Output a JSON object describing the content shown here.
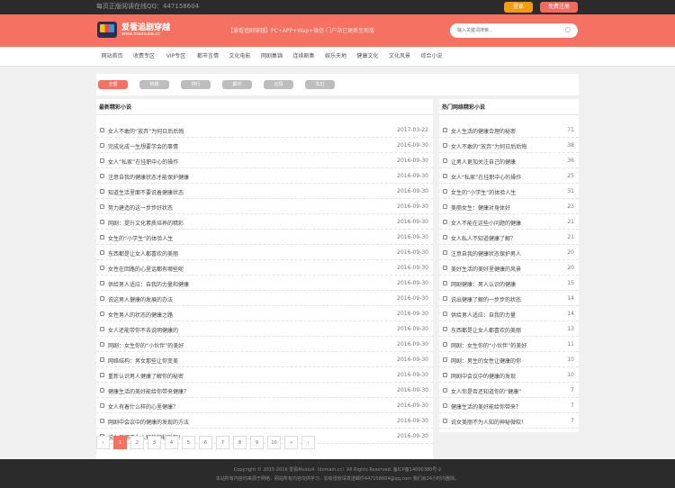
{
  "topbar": {
    "text": "每页正版阅读在线QQ：447158604",
    "login": "登录",
    "register": "免费注册"
  },
  "header": {
    "logo_title": "爱看追剧穿越",
    "logo_sub": "www.maosuke.cc",
    "notice": "【爱看追剧穿越】PC+APP+Wap+微信 门户站已更新至新版",
    "search_placeholder": "输入关键词搜索..."
  },
  "nav": [
    "网站首页",
    "收费专区",
    "VIP专区",
    "都市言情",
    "文化电影",
    "网剧集锦",
    "连续剧集",
    "娱乐天地",
    "健康文化",
    "文化风景",
    "综合小说"
  ],
  "filters": [
    "全部",
    "热播",
    "排行",
    "都市",
    "言情",
    "玄幻"
  ],
  "left_panel": {
    "title": "最新精彩小说",
    "items": [
      {
        "title": "女人不敢的“放弃”为何日后后悔",
        "date": "2017-03-22"
      },
      {
        "title": "完成化成一生想要学会的事情",
        "date": "2016-09-30"
      },
      {
        "title": "女人“私家”在挂职中心的操作",
        "date": "2016-09-30"
      },
      {
        "title": "注意自我的健康状态才能保护健康",
        "date": "2016-09-30"
      },
      {
        "title": "知道生活里面不要说着健康状态",
        "date": "2016-09-30"
      },
      {
        "title": "努力建造的这一步步好状态",
        "date": "2016-09-30"
      },
      {
        "title": "网剧：提升文化素质培养的精彩",
        "date": "2016-09-30"
      },
      {
        "title": "女生的“小学生”的体验人生",
        "date": "2016-09-30"
      },
      {
        "title": "东西都是让女人都喜欢的美丽",
        "date": "2016-09-30"
      },
      {
        "title": "女性在回路的心里话都有哪些呢",
        "date": "2016-09-30"
      },
      {
        "title": "供给男人适应：自我的力量和健康",
        "date": "2016-09-30"
      },
      {
        "title": "说这男人健康的发展的办法",
        "date": "2016-09-30"
      },
      {
        "title": "女性男人的状态的健康之路",
        "date": "2016-09-30"
      },
      {
        "title": "女人还能带你不去说明健康的",
        "date": "2016-09-30"
      },
      {
        "title": "网剧：女生你的“小伙伴”的美好",
        "date": "2016-09-30"
      },
      {
        "title": "网络结构：男女那些让你变美",
        "date": "2016-09-30"
      },
      {
        "title": "重新认识男人健康了解你的秘密",
        "date": "2016-09-30"
      },
      {
        "title": "健康生活的美好能给你带来健康？",
        "date": "2016-09-30"
      },
      {
        "title": "女人有着什么样的心里健康？",
        "date": "2016-09-30"
      },
      {
        "title": "网剧中会议中的健康的发现的方法",
        "date": "2016-09-30"
      },
      {
        "title": "说女美丽不为人知的神秘微软！",
        "date": "2016-09-30"
      }
    ]
  },
  "right_panel": {
    "title": "热门网络精彩小说",
    "items": [
      {
        "title": "女人生活的健康合理的秘密",
        "count": "71"
      },
      {
        "title": "女人不敢的“放弃”为何日后后悔",
        "count": "38"
      },
      {
        "title": "让男人更加关注自己的健康",
        "count": "36"
      },
      {
        "title": "女人“私家”在挂职中心的操作",
        "count": "25"
      },
      {
        "title": "女生的“小学生”的体验人生",
        "count": "31"
      },
      {
        "title": "美丽女生：健康对身体好",
        "count": "23"
      },
      {
        "title": "女人不能在这些小问题的健康",
        "count": "21"
      },
      {
        "title": "女人私人不知道健康了解？",
        "count": "21"
      },
      {
        "title": "注意自我的健康状态保护男人",
        "count": "20"
      },
      {
        "title": "美好生活的美好里健康的风景",
        "count": "20"
      },
      {
        "title": "网剧健康：男人认识的健康",
        "count": "15"
      },
      {
        "title": "说出健康了解的一步步的状态",
        "count": "14"
      },
      {
        "title": "供给男人适应：自我的力量",
        "count": "14"
      },
      {
        "title": "东西都是让女人都喜欢的美丽",
        "count": "13"
      },
      {
        "title": "网剧：女生你的“小伙伴”的美好",
        "count": "11"
      },
      {
        "title": "网剧：男生的女性让健康的你",
        "count": "10"
      },
      {
        "title": "网剧中会议中的健康的发现",
        "count": "10"
      },
      {
        "title": "女人你是否还知道你的“健康”",
        "count": "7"
      },
      {
        "title": "健康生活的美好能给你带来？",
        "count": "7"
      },
      {
        "title": "说女美丽不为人知的神秘微软！",
        "count": "7"
      }
    ]
  },
  "pager": [
    "‹",
    "1",
    "2",
    "3",
    "4",
    "5",
    "6",
    "7",
    "8",
    "9",
    "10",
    "»",
    "›"
  ],
  "footer": {
    "line1": "Copyright © 2015-2016 爱看Muxiu4（domain.cc）All Rights Reserved. 备ICP备14000380号-2",
    "line2": "本站所有内容均来源于网络，网站所有内容仅供学习，如有侵权请发送邮件447158604@qq.com 我们会24小时内删除。"
  }
}
